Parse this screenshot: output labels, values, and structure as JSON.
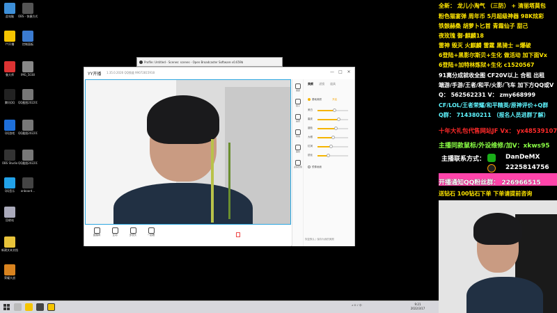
{
  "desktop": {
    "icons": [
      {
        "name": "此电脑",
        "color": "#3d8fd8"
      },
      {
        "name": "OBS - 快捷方式",
        "color": "#555555"
      },
      {
        "name": "YY开播",
        "color": "#f5c400"
      },
      {
        "name": "控制面板",
        "color": "#3b7bd0"
      },
      {
        "name": "鲁大师",
        "color": "#d33"
      },
      {
        "name": "IMG_5038",
        "color": "#888888"
      },
      {
        "name": "腾讯QQ",
        "color": "#222222"
      },
      {
        "name": "QQ截图20220317",
        "color": "#777777"
      },
      {
        "name": "QQ游戏",
        "color": "#1e6fd9"
      },
      {
        "name": "QQ截图20220317...",
        "color": "#777777"
      },
      {
        "name": "OBS Studio",
        "color": "#333333"
      },
      {
        "name": "QQ截图20220317...",
        "color": "#777777"
      },
      {
        "name": "QQ音乐",
        "color": "#22a2e8"
      },
      {
        "name": "onboard...",
        "color": "#444444"
      },
      {
        "name": "回收站",
        "color": "#aab"
      },
      {
        "name": "新建文本文档",
        "color": "#e8c33a"
      },
      {
        "name": "荣耀大战",
        "color": "#d9831f"
      }
    ]
  },
  "obs_window": {
    "title": "Profile: Untitled - Scenes: scenes - Open Broadcaster Software v0.659b"
  },
  "yy_window": {
    "app_name": "YY开播",
    "meta": "1.35.0.2026  QQ频道  99072815918",
    "controls": {
      "minimize": "—",
      "maximize": "□",
      "close": "✕"
    },
    "right_panel": {
      "side_tabs": [
        "美颜",
        "镜子",
        "画质",
        "特效",
        "美妆",
        "虚拟形象"
      ],
      "tabs": [
        "美颜",
        "滤镜",
        "道具"
      ],
      "active_tab": "美颜",
      "toggle_beauty": "基础美颜",
      "toggle_beauty_state": "开启",
      "sliders": [
        {
          "label": "美白",
          "value": 0.55
        },
        {
          "label": "磨皮",
          "value": 0.7
        },
        {
          "label": "瘦脸",
          "value": 0.6
        },
        {
          "label": "大眼",
          "value": 0.5
        },
        {
          "label": "红润",
          "value": 0.45
        },
        {
          "label": "锐化",
          "value": 0.35
        }
      ],
      "toggle_mirror": "镜像画面",
      "footer": "恢复默认  |  保存为我的美颜"
    },
    "bottom_bar": [
      {
        "label": "直播间",
        "icon": "broadcast-icon"
      },
      {
        "label": "互动",
        "icon": "interact-icon"
      },
      {
        "label": "多镜头",
        "icon": "camera-icon"
      },
      {
        "label": "一起看",
        "icon": "watch-together-icon"
      }
    ]
  },
  "taskbar": {
    "time": "9:21",
    "date": "2022/3/17",
    "tray": "∧  ⊡  ♪  中"
  },
  "sidebar": {
    "lines": [
      {
        "text": "全新： 龙儿小淘气 （三防） + 清丽塔莫包",
        "style": "yellow"
      },
      {
        "text": "粉色猫宴弹 周年币 5月超级神器 98K炫彩",
        "style": "yellow"
      },
      {
        "text": "铁骸赫桑 胡萝卜匕首 青霜仙子 甜己",
        "style": "yellow"
      },
      {
        "text": "夜玫瑰 御·麒麟18",
        "style": "yellow"
      },
      {
        "text": "雷神 毁灭 火麒麟 雷霆 黑骑士 =爆破",
        "style": "yellow"
      },
      {
        "text": "6登陆+黑影尔斯贝+生化   做活动 加下面Vx",
        "style": "yellow"
      },
      {
        "text": "6登陆+加特林炼狱+生化       c1520567",
        "style": "yellow"
      },
      {
        "text": "91离分成就收全图 CF20V以上   合租 出租",
        "style": "white"
      },
      {
        "text": "端游/手游/王者/和平/火影/飞车 加下方QQ或V",
        "style": "white"
      },
      {
        "text": "Q： 562562231 V： zmy668999",
        "style": "white"
      },
      {
        "text": "CF/LOL/王者荣耀/和平精英/原神评价+Q群",
        "style": "cyan"
      },
      {
        "text": "Q群： 714380211  （报名人员进群了解）",
        "style": "cyan"
      },
      {
        "text": "十年大礼包代售网站JF Vx： yx485391079",
        "style": "red"
      },
      {
        "text": "主播同款鼠标/外设维修/加V：xkws95",
        "style": "green"
      },
      {
        "text": "开播通知QQ粉丝群：  226966515",
        "style": "pink"
      },
      {
        "text": "送钻石 100钻石下单  下单请提前咨询",
        "style": "yellow"
      }
    ],
    "contact_label": "主播联系方式：",
    "wechat": "DanDeMX",
    "qq": "2225814756"
  }
}
